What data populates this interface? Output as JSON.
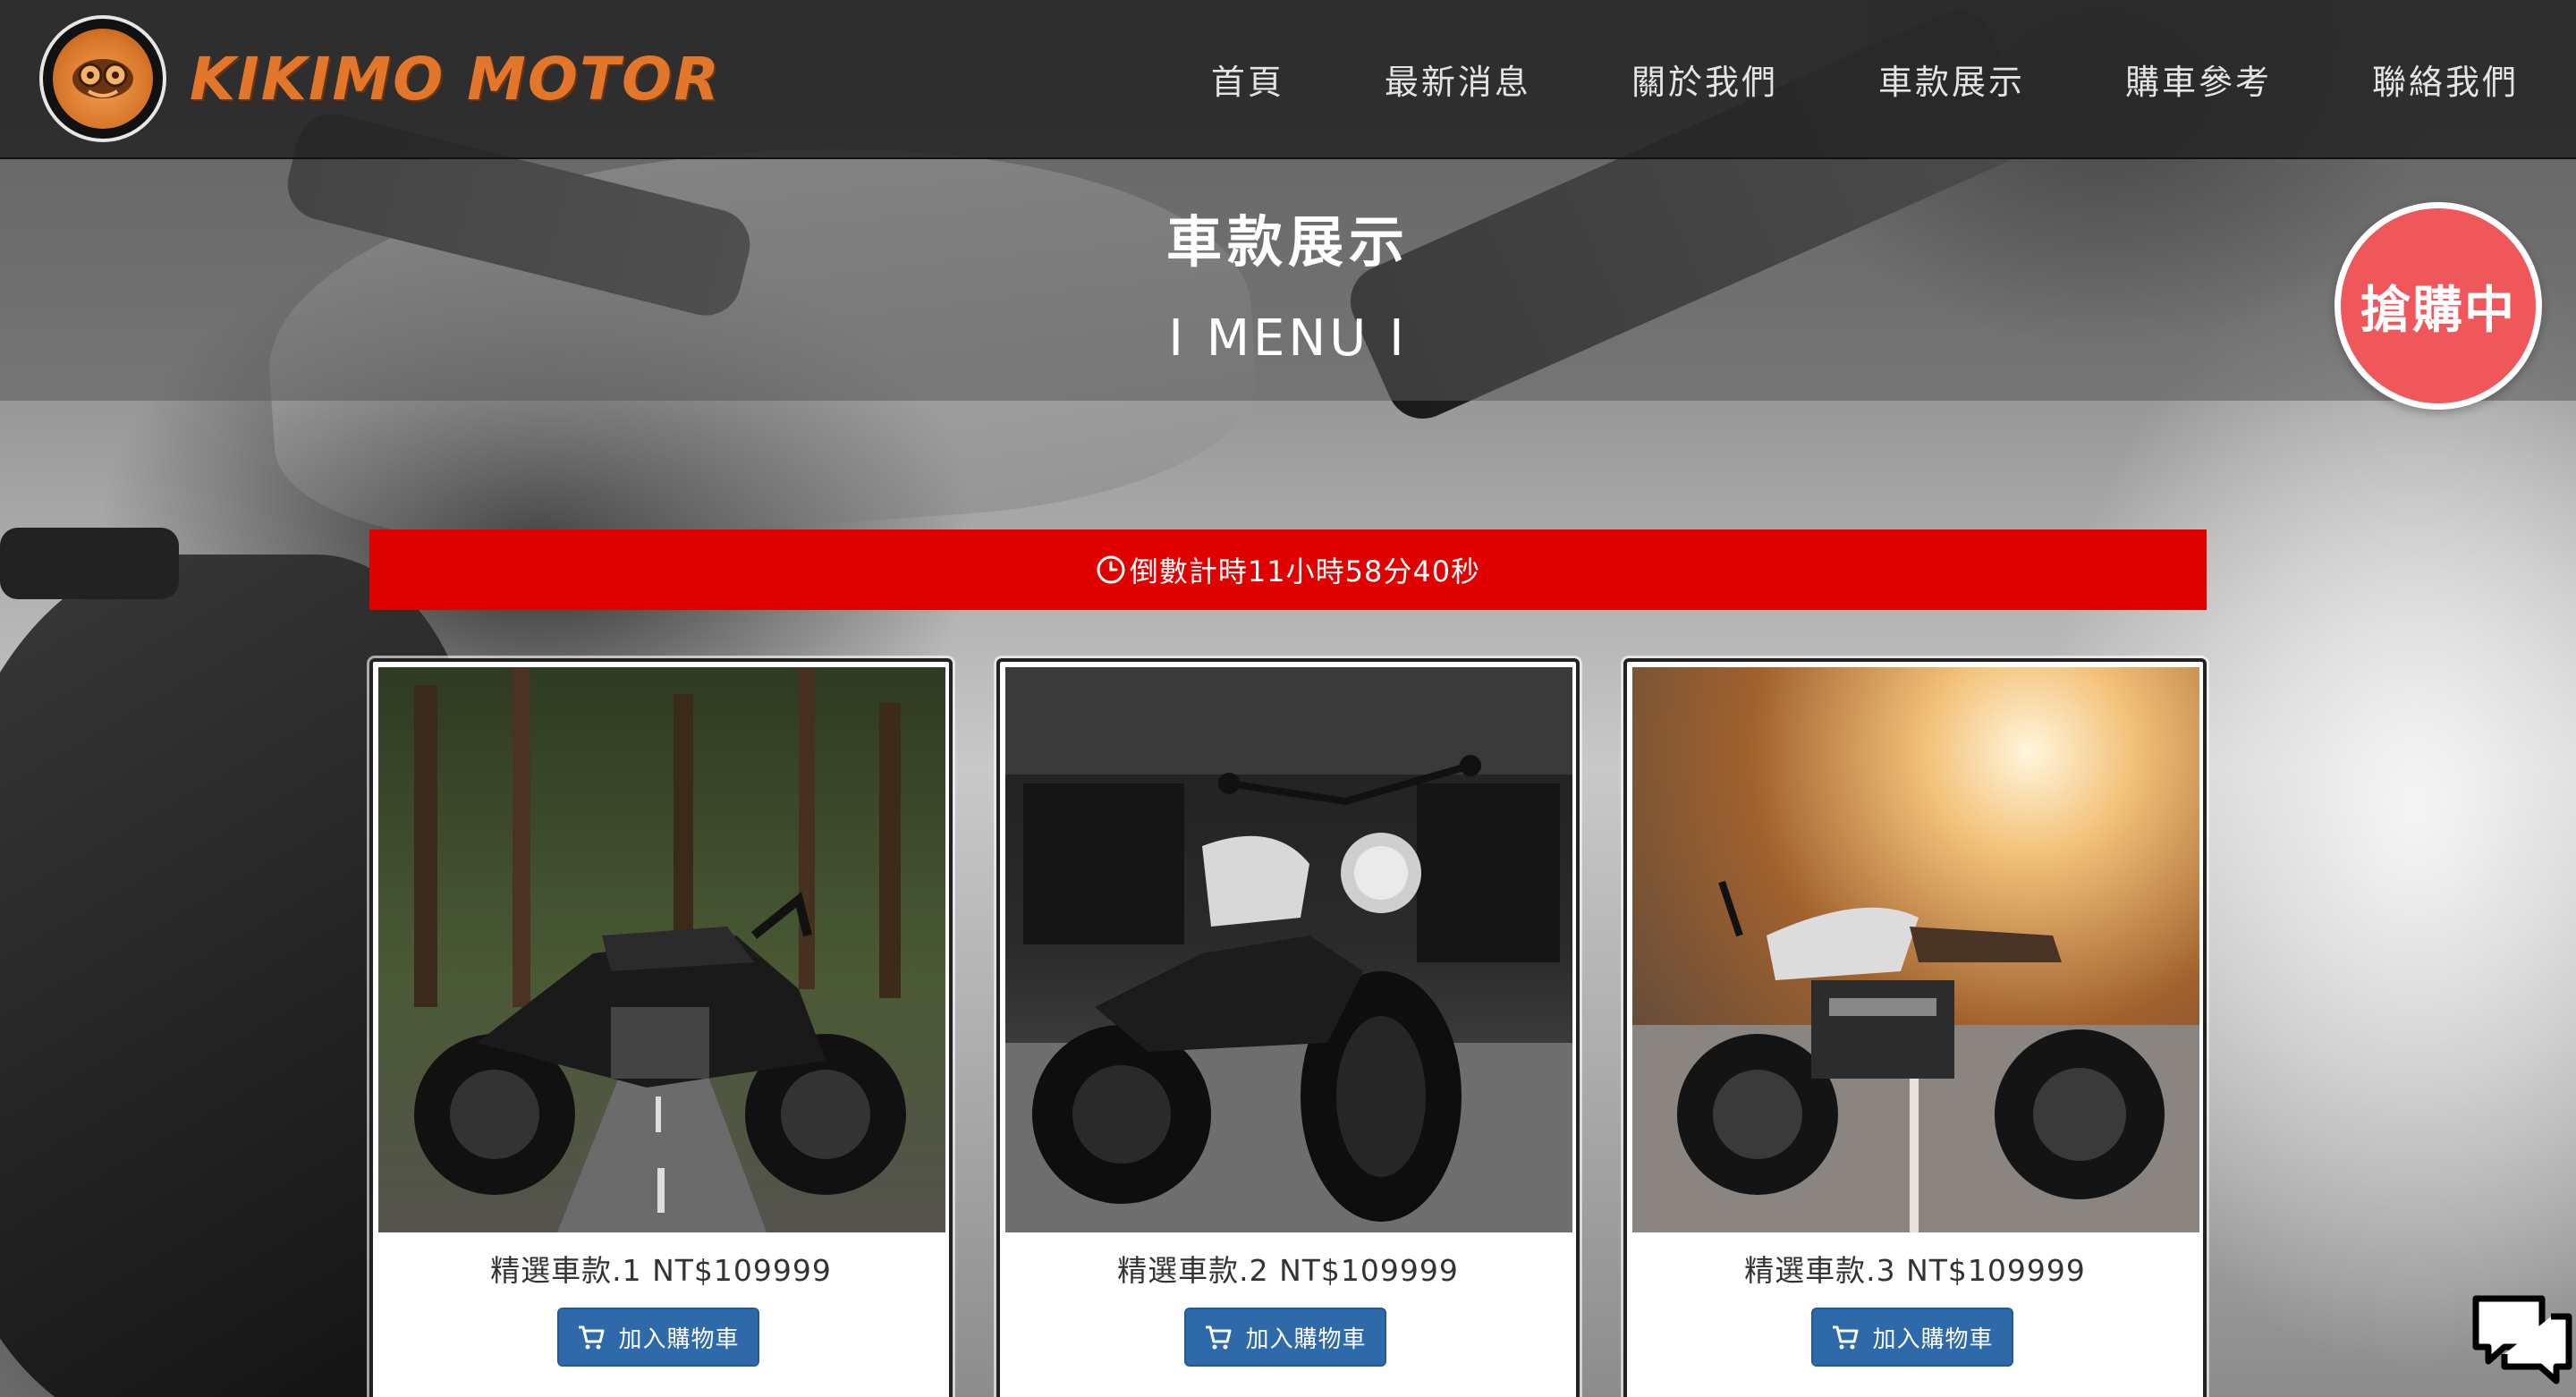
{
  "brand": {
    "name": "KIKIMO MOTOR",
    "logo_icon": "kikimo-logo-icon"
  },
  "nav": {
    "items": [
      {
        "label": "首頁"
      },
      {
        "label": "最新消息"
      },
      {
        "label": "關於我們"
      },
      {
        "label": "車款展示"
      },
      {
        "label": "購車參考"
      },
      {
        "label": "聯絡我們"
      }
    ]
  },
  "hero": {
    "title": "車款展示",
    "subtitle": "I MENU I"
  },
  "badge": {
    "label": "搶購中",
    "color": "#f0575a"
  },
  "countdown": {
    "icon": "clock-icon",
    "text": "倒數計時11小時58分40秒",
    "color": "#e10000"
  },
  "products": [
    {
      "title": "精選車款.1 NT$109999",
      "button_label": "加入購物車",
      "image": "naked-motorcycle-forest-road"
    },
    {
      "title": "精選車款.2 NT$109999",
      "button_label": "加入購物車",
      "image": "cruiser-motorcycle-street"
    },
    {
      "title": "精選車款.3 NT$109999",
      "button_label": "加入購物車",
      "image": "cafe-racer-motorcycle-sunset"
    }
  ],
  "colors": {
    "button_blue": "#2e6aa9",
    "brand_orange": "#e2762a"
  },
  "chat": {
    "icon": "chat-bubbles-icon"
  }
}
